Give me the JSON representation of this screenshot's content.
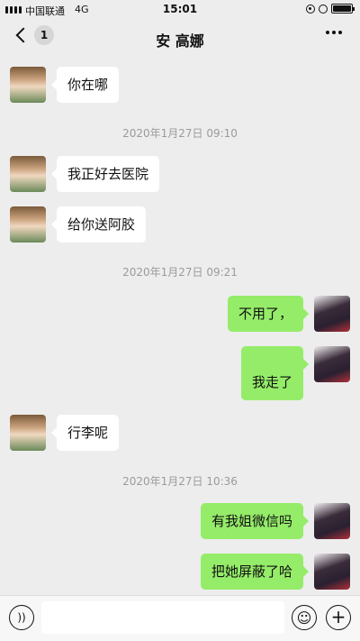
{
  "status_bar": {
    "carrier": "中国联通",
    "network": "4G",
    "time": "15:01",
    "icons": [
      "signal-icon",
      "lock-rotation-icon",
      "alarm-icon",
      "battery-icon"
    ]
  },
  "nav": {
    "back_icon": "chevron-left-icon",
    "unread_count": "1",
    "title": "安 高娜",
    "more_icon": "more-icon"
  },
  "messages": [
    {
      "side": "left",
      "avatar": "girl-avatar",
      "text": "你在哪"
    },
    {
      "timestamp": "2020年1月27日 09:10"
    },
    {
      "side": "left",
      "avatar": "girl-avatar",
      "text": "我正好去医院"
    },
    {
      "side": "left",
      "avatar": "girl-avatar",
      "text": "给你送阿胶"
    },
    {
      "timestamp": "2020年1月27日 09:21"
    },
    {
      "side": "right",
      "avatar": "anime-avatar",
      "text": "不用了，"
    },
    {
      "side": "right",
      "avatar": "anime-avatar",
      "text": "我走了"
    },
    {
      "side": "left",
      "avatar": "girl-avatar",
      "text": "行李呢"
    },
    {
      "timestamp": "2020年1月27日 10:36"
    },
    {
      "side": "right",
      "avatar": "anime-avatar",
      "text": "有我姐微信吗"
    },
    {
      "side": "right",
      "avatar": "anime-avatar",
      "text": "把她屏蔽了哈"
    }
  ],
  "input_bar": {
    "voice_icon": "voice-icon",
    "input_value": "",
    "emoji_icon": "emoji-icon",
    "plus_icon": "plus-icon"
  },
  "colors": {
    "background": "#ededed",
    "bubble_sent": "#95ec69",
    "bubble_received": "#ffffff",
    "timestamp_text": "#9b9b9b"
  }
}
